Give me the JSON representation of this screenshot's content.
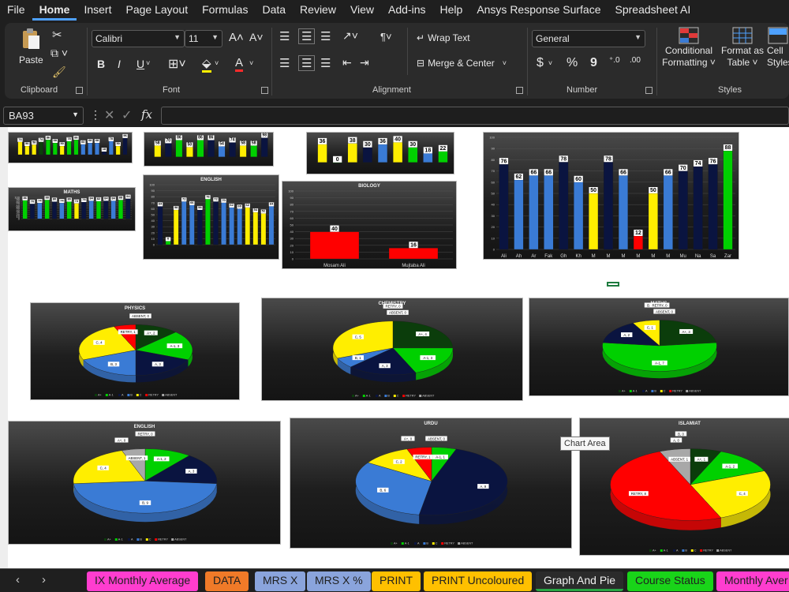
{
  "menu": [
    "File",
    "Home",
    "Insert",
    "Page Layout",
    "Formulas",
    "Data",
    "Review",
    "View",
    "Add-ins",
    "Help",
    "Ansys Response Surface",
    "Spreadsheet AI"
  ],
  "ribbon": {
    "clipboard": {
      "paste": "Paste",
      "label": "Clipboard"
    },
    "font": {
      "name": "Calibri",
      "size": "11",
      "label": "Font",
      "bold": "B",
      "italic": "I",
      "underline": "U"
    },
    "alignment": {
      "wrap": "Wrap Text",
      "merge": "Merge & Center",
      "label": "Alignment"
    },
    "number": {
      "format": "General",
      "label": "Number",
      "currency": "$",
      "percent": "%",
      "comma": "9"
    },
    "styles": {
      "conditional": "Conditional",
      "conditional2": "Formatting",
      "format_table": "Format as",
      "format_table2": "Table",
      "cell": "Cell",
      "cell2": "Styles",
      "label": "Styles"
    }
  },
  "formula_bar": {
    "namebox": "BA93",
    "fx": "fx"
  },
  "tooltip": "Chart Area",
  "colors": {
    "aplus": "#0b3d0b",
    "a1": "#00d000",
    "a": "#0a1440",
    "b": "#3a7bd5",
    "c": "#ffee00",
    "retry": "#ff0000",
    "absent": "#a8a8a8"
  },
  "pie_legend": [
    "A+",
    "A-1",
    "A",
    "B",
    "C",
    "RETRY",
    "ABSENT"
  ],
  "pies": [
    {
      "title": "PHYSICS",
      "labels": [
        "A+, 2",
        "A-1, 3",
        "A, 3",
        "B, 3",
        "C, 4",
        "RETRY, 1",
        "ABSENT, 0"
      ],
      "values": [
        2,
        3,
        3,
        3,
        4,
        1,
        0
      ]
    },
    {
      "title": "CHEMISTRY",
      "labels": [
        "A+, 4",
        "A-1, 3",
        "A, 3",
        "B, 1",
        "C, 5",
        "RETRY, 0",
        "ABSENT, 0"
      ],
      "values": [
        4,
        3,
        3,
        1,
        5,
        0,
        0
      ]
    },
    {
      "title": "MATHS",
      "labels": [
        "A+, 3",
        "A-1, 7",
        "A, 2",
        "B, 0",
        "C, 1",
        "RETRY, 0",
        "ABSENT, 0"
      ],
      "values": [
        3,
        7,
        2,
        0,
        1,
        0,
        0
      ]
    },
    {
      "title": "ENGLISH",
      "labels": [
        "A+, 0",
        "A-1, 2",
        "A, 3",
        "B, 9",
        "C, 4",
        "RETRY, 0",
        "ABSENT, 1"
      ],
      "values": [
        0,
        2,
        3,
        9,
        4,
        0,
        1
      ]
    },
    {
      "title": "URDU",
      "labels": [
        "A+, 0",
        "A-1, 1",
        "A, 9",
        "B, 6",
        "C, 2",
        "RETRY, 1",
        "ABSENT, 0"
      ],
      "values": [
        0,
        1,
        9,
        6,
        2,
        1,
        0
      ]
    },
    {
      "title": "ISLAMIAT",
      "labels": [
        "A+, 1",
        "A-1, 2",
        "A, 0",
        "B, 0",
        "C, 4",
        "RETRY, 8",
        "ABSENT, 1"
      ],
      "values": [
        1,
        2,
        0,
        0,
        4,
        8,
        1
      ]
    }
  ],
  "bar_charts": [
    {
      "title": "",
      "values": [
        74,
        50,
        58,
        74,
        86,
        68,
        50,
        78,
        86,
        60,
        68,
        68,
        18,
        78,
        50,
        96
      ],
      "colors": [
        "c",
        "c",
        "c",
        "aplus",
        "a1",
        "a1",
        "c",
        "a1",
        "a1",
        "b",
        "b",
        "b",
        "a",
        "b",
        "c",
        "a"
      ]
    },
    {
      "title": "",
      "values": [
        58,
        70,
        86,
        50,
        86,
        86,
        54,
        74,
        58,
        58,
        98
      ],
      "colors": [
        "c",
        "a",
        "a1",
        "c",
        "a1",
        "a",
        "b",
        "a",
        "c",
        "a1",
        "a"
      ]
    },
    {
      "title": "",
      "values": [
        36,
        0,
        38,
        30,
        36,
        40,
        30,
        18,
        22
      ],
      "colors": [
        "c",
        "a1",
        "c",
        "a",
        "b",
        "c",
        "a1",
        "b",
        "a1"
      ]
    },
    {
      "title": "MATHS",
      "values": [
        86,
        70,
        74,
        88,
        80,
        74,
        80,
        72,
        78,
        84,
        82,
        84,
        84,
        88,
        94
      ],
      "colors": [
        "a1",
        "a",
        "b",
        "a1",
        "a",
        "b",
        "a1",
        "c",
        "a",
        "b",
        "a1",
        "a",
        "b",
        "a1",
        "a"
      ]
    },
    {
      "title": "ENGLISH",
      "values": [
        64,
        6,
        58,
        72,
        66,
        58,
        76,
        72,
        70,
        62,
        60,
        62,
        54,
        52,
        64
      ],
      "colors": [
        "a",
        "a1",
        "c",
        "b",
        "b",
        "a",
        "a1",
        "a",
        "b",
        "b",
        "b",
        "c",
        "c",
        "c",
        "b"
      ]
    },
    {
      "title": "BIOLOGY",
      "values": [
        40,
        16
      ],
      "colors": [
        "retry",
        "retry"
      ],
      "categories": [
        "Mosam Ali",
        "Mujtaba Ali"
      ]
    },
    {
      "title": "",
      "values": [
        76,
        62,
        66,
        66,
        78,
        60,
        50,
        78,
        66,
        12,
        50,
        66,
        70,
        74,
        76,
        88
      ],
      "colors": [
        "a",
        "b",
        "b",
        "b",
        "a",
        "b",
        "c",
        "a",
        "b",
        "retry",
        "c",
        "b",
        "a",
        "a",
        "a",
        "a1"
      ],
      "categories": [
        "Ali",
        "Ah",
        "Ar",
        "Fak",
        "Gh",
        "Kh",
        "M",
        "M",
        "M",
        "M",
        "M",
        "M",
        "Mu",
        "Na",
        "Sa",
        "Zar"
      ]
    }
  ],
  "tabs": [
    {
      "label": "IX Monthly Average",
      "color": "#ff3dcf"
    },
    {
      "label": "DATA",
      "color": "#f07a28"
    },
    {
      "label": "MRS X",
      "color": "#8aa4dc"
    },
    {
      "label": "MRS X %",
      "color": "#8aa4dc"
    },
    {
      "label": "PRINT",
      "color": "#ffc000"
    },
    {
      "label": "PRINT Uncoloured",
      "color": "#ffc000"
    },
    {
      "label": "Graph And Pie",
      "color": "active"
    },
    {
      "label": "Course Status",
      "color": "#19d419"
    },
    {
      "label": "Monthly Aver",
      "color": "#ff3dcf"
    }
  ]
}
